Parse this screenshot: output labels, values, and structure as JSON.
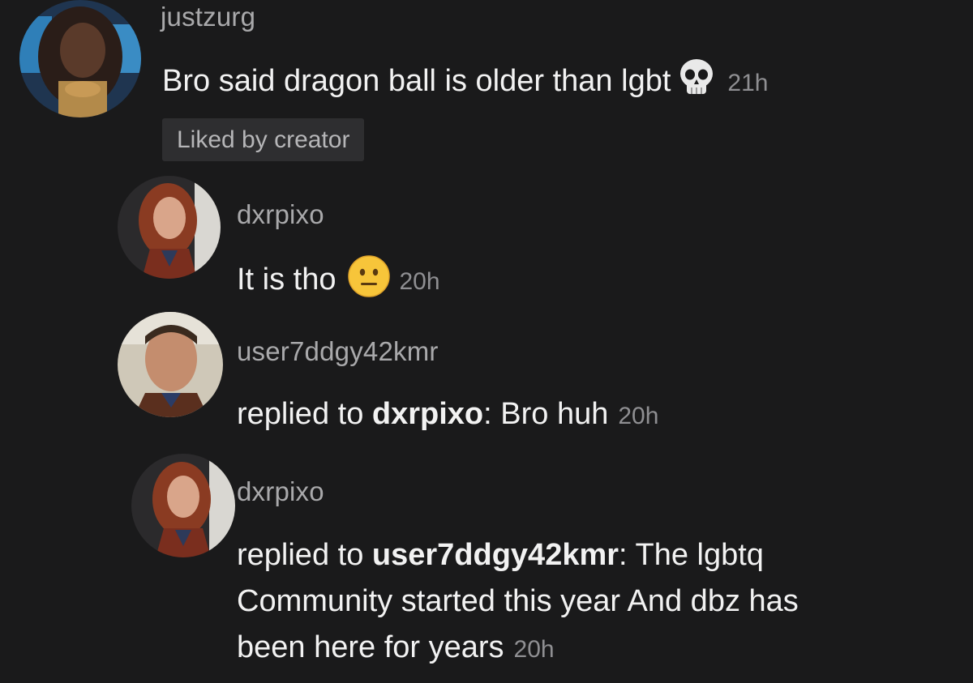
{
  "comments": [
    {
      "username": "justzurg",
      "text": "Bro said dragon ball is older than lgbt",
      "emoji": "skull-emoji",
      "time": "21h",
      "badge": "Liked by creator"
    },
    {
      "username": "dxrpixo",
      "text": "It is tho",
      "emoji": "neutral-face-emoji",
      "time": "20h"
    },
    {
      "username": "user7ddgy42kmr",
      "prefix": "replied to ",
      "mention": "dxrpixo",
      "separator": ":",
      "text": " Bro huh",
      "time": "20h"
    },
    {
      "username": "dxrpixo",
      "prefix": "replied to ",
      "mention": "user7ddgy42kmr",
      "separator": ":",
      "line1": " The lgbtq",
      "line2": "Community started this year And dbz has",
      "line3": "been here for years",
      "time": "20h"
    }
  ],
  "colors": {
    "background": "#1a1a1b",
    "username": "#a9a9ab",
    "text": "#f2f2f2",
    "time": "#8f8f92",
    "badge_bg": "#2e2e30"
  }
}
